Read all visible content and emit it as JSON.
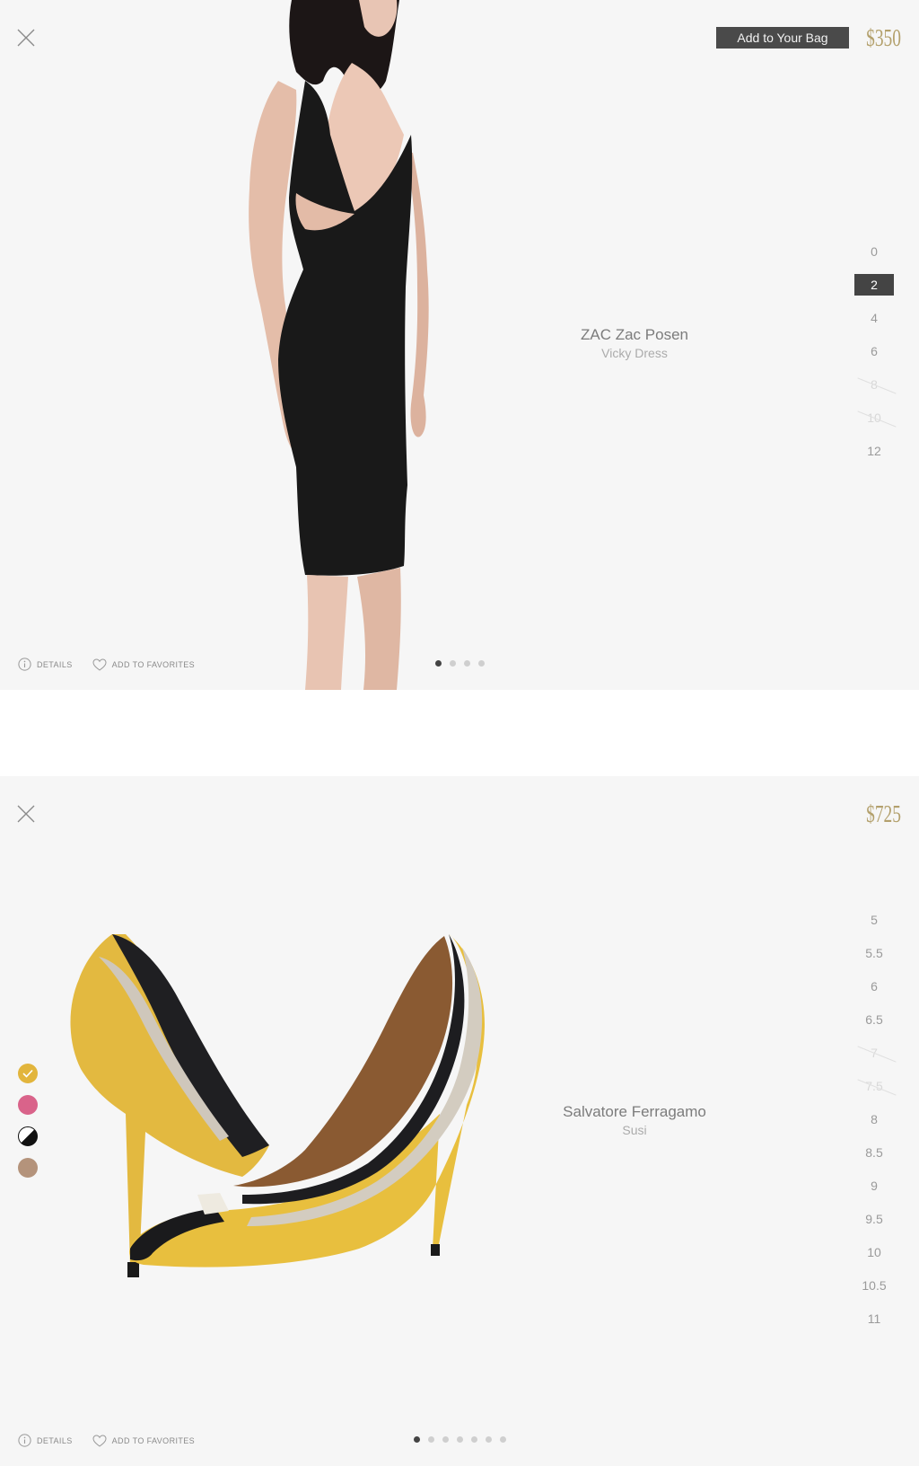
{
  "card1": {
    "add_to_bag_label": "Add to Your Bag",
    "price": "$350",
    "brand": "ZAC Zac Posen",
    "product_name": "Vicky Dress",
    "sizes": [
      {
        "label": "0",
        "state": "available"
      },
      {
        "label": "2",
        "state": "selected"
      },
      {
        "label": "4",
        "state": "available"
      },
      {
        "label": "6",
        "state": "available"
      },
      {
        "label": "8",
        "state": "unavailable"
      },
      {
        "label": "10",
        "state": "unavailable"
      },
      {
        "label": "12",
        "state": "available"
      }
    ],
    "details_label": "DETAILS",
    "favorites_label": "ADD TO FAVORITES",
    "image_count": 4,
    "active_image": 1
  },
  "card2": {
    "price": "$725",
    "brand": "Salvatore Ferragamo",
    "product_name": "Susi",
    "sizes": [
      {
        "label": "5",
        "state": "available"
      },
      {
        "label": "5.5",
        "state": "available"
      },
      {
        "label": "6",
        "state": "available"
      },
      {
        "label": "6.5",
        "state": "available"
      },
      {
        "label": "7",
        "state": "unavailable"
      },
      {
        "label": "7.5",
        "state": "unavailable"
      },
      {
        "label": "8",
        "state": "available"
      },
      {
        "label": "8.5",
        "state": "available"
      },
      {
        "label": "9",
        "state": "available"
      },
      {
        "label": "9.5",
        "state": "available"
      },
      {
        "label": "10",
        "state": "available"
      },
      {
        "label": "10.5",
        "state": "available"
      },
      {
        "label": "11",
        "state": "available"
      }
    ],
    "color_swatches": [
      {
        "name": "yellow",
        "color": "#e2b53c",
        "selected": true
      },
      {
        "name": "pink",
        "color": "#d9638a",
        "selected": false
      },
      {
        "name": "black-white",
        "color": "#111111",
        "selected": false
      },
      {
        "name": "taupe",
        "color": "#b4937b",
        "selected": false
      }
    ],
    "details_label": "DETAILS",
    "favorites_label": "ADD TO FAVORITES",
    "image_count": 7,
    "active_image": 1
  },
  "colors": {
    "price_gold": "#b3a06c",
    "dark_button": "#4a4a4a",
    "background": "#f6f6f6"
  }
}
